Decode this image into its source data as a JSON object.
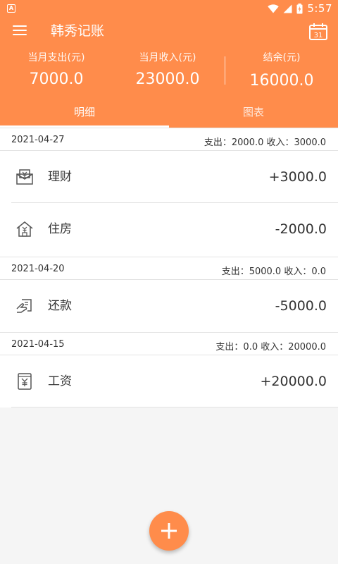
{
  "status_bar": {
    "app_icon": "A",
    "time": "5:57"
  },
  "toolbar": {
    "title": "韩秀记账",
    "menu_icon": "hamburger-menu-icon",
    "calendar_icon": "calendar-icon",
    "calendar_day": "31"
  },
  "summary": {
    "expense_label": "当月支出(元)",
    "expense_value": "7000.0",
    "income_label": "当月收入(元)",
    "income_value": "23000.0",
    "balance_label": "结余(元)",
    "balance_value": "16000.0"
  },
  "tabs": [
    {
      "label": "明细",
      "selected": true
    },
    {
      "label": "图表",
      "selected": false
    }
  ],
  "groups": [
    {
      "date": "2021-04-27",
      "summary": "支出：2000.0 收入：3000.0",
      "items": [
        {
          "name": "理财",
          "amount": "+3000.0",
          "icon": "finance-icon"
        },
        {
          "name": "住房",
          "amount": "-2000.0",
          "icon": "housing-icon"
        }
      ]
    },
    {
      "date": "2021-04-20",
      "summary": "支出：5000.0 收入：0.0",
      "items": [
        {
          "name": "还款",
          "amount": "-5000.0",
          "icon": "repayment-icon"
        }
      ]
    },
    {
      "date": "2021-04-15",
      "summary": "支出：0.0 收入：20000.0",
      "items": [
        {
          "name": "工资",
          "amount": "+20000.0",
          "icon": "salary-icon"
        }
      ]
    }
  ],
  "colors": {
    "primary": "#ff8c4b",
    "background": "#f5f5f5",
    "divider": "#e3e3e3",
    "text": "#333333"
  }
}
